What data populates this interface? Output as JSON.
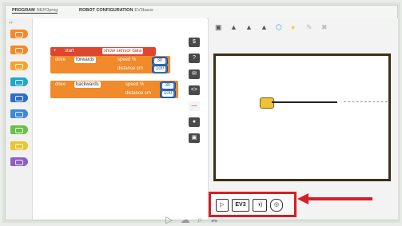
{
  "topbar": {
    "tab_program": "PROGRAM",
    "program_name": "NEPOprog",
    "tab_config": "ROBOT CONFIGURATION",
    "config_name": "EV3basis"
  },
  "palette": {
    "zoom_label": "+/-"
  },
  "program": {
    "start_label": "start",
    "sensor_field": "show sensor data",
    "drive1": {
      "label": "drive",
      "direction": "forwards",
      "speed_label": "speed %",
      "speed": "30",
      "distance_label": "distance cm",
      "distance": "100"
    },
    "drive2": {
      "label": "drive",
      "direction": "backwards",
      "speed_label": "speed %",
      "speed": "30",
      "distance_label": "distance cm",
      "distance": "100"
    }
  },
  "side_tools": [
    "$",
    "?",
    "✉",
    "<>",
    "—",
    "●",
    "▣"
  ],
  "sim_tools": [
    "▣",
    "▲",
    "▲",
    "▲",
    "⬡",
    "●",
    "✎",
    "✖"
  ],
  "bottom_icons": [
    "▷",
    "☁",
    "⌕",
    "✖"
  ],
  "controls": {
    "play": "▷",
    "ev3": "EV3",
    "sound": "◑)",
    "location": "◎"
  },
  "colors": {
    "highlight": "#d61f26",
    "start_block": "#e0452e",
    "drive_block": "#f08a2a",
    "value_block": "#3475c8"
  }
}
